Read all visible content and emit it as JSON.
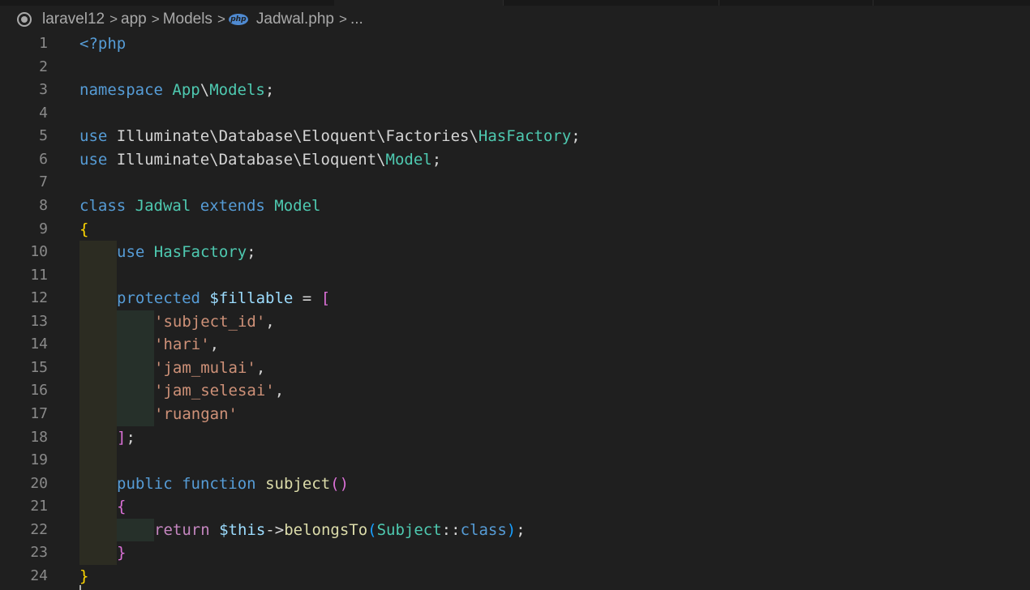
{
  "breadcrumb": {
    "items": [
      "laravel12",
      "app",
      "Models",
      "Jadwal.php",
      "..."
    ],
    "separator": ">",
    "file_icon_label": "php"
  },
  "colors": {
    "background": "#1f1f1f",
    "keyword": "#569cd6",
    "type": "#4ec9b0",
    "string": "#ce9178",
    "variable": "#9cdcfe",
    "function": "#dcdcaa",
    "control": "#c586c0",
    "bracket_level1": "#ffd700",
    "bracket_level2": "#da70d6",
    "bracket_level3": "#179fff",
    "line_number": "#8a8a8a"
  },
  "lines": [
    {
      "n": "1",
      "indent": 0,
      "tokens": [
        [
          "tag",
          "<?php"
        ]
      ]
    },
    {
      "n": "2",
      "indent": 0,
      "tokens": []
    },
    {
      "n": "3",
      "indent": 0,
      "tokens": [
        [
          "kw",
          "namespace"
        ],
        [
          "punc",
          " "
        ],
        [
          "type",
          "App"
        ],
        [
          "punc",
          "\\"
        ],
        [
          "type",
          "Models"
        ],
        [
          "punc",
          ";"
        ]
      ]
    },
    {
      "n": "4",
      "indent": 0,
      "tokens": []
    },
    {
      "n": "5",
      "indent": 0,
      "tokens": [
        [
          "kw",
          "use"
        ],
        [
          "punc",
          " "
        ],
        [
          "ns",
          "Illuminate\\Database\\Eloquent\\Factories\\"
        ],
        [
          "type",
          "HasFactory"
        ],
        [
          "punc",
          ";"
        ]
      ]
    },
    {
      "n": "6",
      "indent": 0,
      "tokens": [
        [
          "kw",
          "use"
        ],
        [
          "punc",
          " "
        ],
        [
          "ns",
          "Illuminate\\Database\\Eloquent\\"
        ],
        [
          "type",
          "Model"
        ],
        [
          "punc",
          ";"
        ]
      ]
    },
    {
      "n": "7",
      "indent": 0,
      "tokens": []
    },
    {
      "n": "8",
      "indent": 0,
      "tokens": [
        [
          "kw",
          "class"
        ],
        [
          "punc",
          " "
        ],
        [
          "type",
          "Jadwal"
        ],
        [
          "punc",
          " "
        ],
        [
          "kw",
          "extends"
        ],
        [
          "punc",
          " "
        ],
        [
          "type",
          "Model"
        ]
      ]
    },
    {
      "n": "9",
      "indent": 0,
      "tokens": [
        [
          "b1",
          "{"
        ]
      ]
    },
    {
      "n": "10",
      "indent": 1,
      "tokens": [
        [
          "kw",
          "use"
        ],
        [
          "punc",
          " "
        ],
        [
          "type",
          "HasFactory"
        ],
        [
          "punc",
          ";"
        ]
      ]
    },
    {
      "n": "11",
      "indent": 0,
      "tokens": []
    },
    {
      "n": "12",
      "indent": 1,
      "tokens": [
        [
          "kw",
          "protected"
        ],
        [
          "punc",
          " "
        ],
        [
          "var",
          "$fillable"
        ],
        [
          "punc",
          " = "
        ],
        [
          "b2",
          "["
        ]
      ]
    },
    {
      "n": "13",
      "indent": 2,
      "tokens": [
        [
          "str",
          "'subject_id'"
        ],
        [
          "punc",
          ","
        ]
      ]
    },
    {
      "n": "14",
      "indent": 2,
      "tokens": [
        [
          "str",
          "'hari'"
        ],
        [
          "punc",
          ","
        ]
      ]
    },
    {
      "n": "15",
      "indent": 2,
      "tokens": [
        [
          "str",
          "'jam_mulai'"
        ],
        [
          "punc",
          ","
        ]
      ]
    },
    {
      "n": "16",
      "indent": 2,
      "tokens": [
        [
          "str",
          "'jam_selesai'"
        ],
        [
          "punc",
          ","
        ]
      ]
    },
    {
      "n": "17",
      "indent": 2,
      "tokens": [
        [
          "str",
          "'ruangan'"
        ]
      ]
    },
    {
      "n": "18",
      "indent": 1,
      "tokens": [
        [
          "b2",
          "]"
        ],
        [
          "punc",
          ";"
        ]
      ]
    },
    {
      "n": "19",
      "indent": 0,
      "tokens": []
    },
    {
      "n": "20",
      "indent": 1,
      "tokens": [
        [
          "kw",
          "public"
        ],
        [
          "punc",
          " "
        ],
        [
          "kw",
          "function"
        ],
        [
          "punc",
          " "
        ],
        [
          "fn",
          "subject"
        ],
        [
          "b2",
          "()"
        ]
      ]
    },
    {
      "n": "21",
      "indent": 1,
      "tokens": [
        [
          "b2",
          "{"
        ]
      ]
    },
    {
      "n": "22",
      "indent": 2,
      "tokens": [
        [
          "ctl",
          "return"
        ],
        [
          "punc",
          " "
        ],
        [
          "var",
          "$this"
        ],
        [
          "punc",
          "->"
        ],
        [
          "fn",
          "belongsTo"
        ],
        [
          "b3",
          "("
        ],
        [
          "type",
          "Subject"
        ],
        [
          "punc",
          "::"
        ],
        [
          "kw",
          "class"
        ],
        [
          "b3",
          ")"
        ],
        [
          "punc",
          ";"
        ]
      ]
    },
    {
      "n": "23",
      "indent": 1,
      "tokens": [
        [
          "b2",
          "}"
        ]
      ]
    },
    {
      "n": "24",
      "indent": 0,
      "tokens": [
        [
          "b1",
          "}"
        ]
      ]
    }
  ]
}
